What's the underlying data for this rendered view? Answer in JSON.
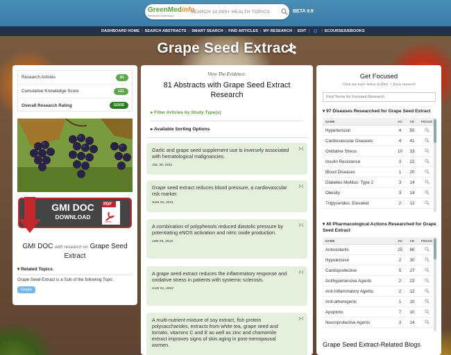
{
  "header": {
    "logo_main": "GreenMed",
    "logo_accent": "info",
    "logo_sub": "Research Dashboard",
    "search_placeholder": "SEARCH 10,000+ HEALTH TOPICS",
    "beta": "BETA 9.8"
  },
  "nav": {
    "items": [
      "DASHBOARD HOME",
      "SEARCH ABSTRACTS",
      "SMART SEARCH",
      "FIND ARTICLES",
      "MY RESEARCH",
      "EDIT"
    ],
    "google_glyph": "G",
    "last": "ECOURSES/EBOOKS"
  },
  "page": {
    "title": "Grape Seed Extract"
  },
  "stats": [
    {
      "label": "Research Articles",
      "value": "81"
    },
    {
      "label": "Cumulative Knowledge Score",
      "value": "131"
    },
    {
      "label": "Overall Research Rating",
      "value": "GOOD"
    }
  ],
  "gmi": {
    "title": "GMI DOC",
    "sub": "DOWNLOAD",
    "pdf": "PDF",
    "adobe": "Adobe",
    "caption_a": "GMI DOC",
    "caption_small": "with research on",
    "caption_b": "Grape Seed Extract"
  },
  "related": {
    "heading": "Related Topics",
    "desc": "Grape Seed Extract is a Sub of the following Topic",
    "tag": "Grape"
  },
  "middle": {
    "view_evidence": "View The Evidence:",
    "abstracts_title": "81 Abstracts with Grape Seed Extract Research",
    "filter_link": "Filter Articles by Study Type(s)",
    "sort_link": "Available Sorting Options",
    "cards": [
      {
        "title": "Garlic and grape seed supplement use is inversely associated with hematological malignancies.",
        "date": "JUL 29, 2011",
        "plus": "[+]"
      },
      {
        "title": "Grape seed extract reduces blood pressure, a cardiovascular risk marker.",
        "date": "AUG 01, 2011",
        "plus": "[+]"
      },
      {
        "title": "A combination of polyphenols reduced diastolic pressure by potentiating eNOS activation and nitric oxide production.",
        "date": "JUN 09, 2015",
        "plus": "[+]"
      },
      {
        "title": "A grape seed extract reduces the inflammatory response and oxidative stress in patients with systemic sclerosis.",
        "date": "AUG 01, 2002",
        "plus": "[+]"
      },
      {
        "title": "A multi-nutrient mixture of soy extract, fish protein polysaccharides, extracts from white tea, grape seed and tomato, vitamins C and E as well as zinc and chamomile extract improves signs of skin aging in post-menopausal women.",
        "date": "",
        "plus": "[+]"
      }
    ]
  },
  "right": {
    "title": "Get Focused",
    "subtitle": "Click any topic below to filter + focus research",
    "find_placeholder": "Find Terms for Focused Research",
    "diseases_heading": "97 Diseases Researched for Grape Seed Extract",
    "pharma_heading": "40 Pharmacological Actions Researched for Grape Seed Extract",
    "col_name": "NAME",
    "col_ac": "AC",
    "col_ck": "CK",
    "col_focus": "FOCUS",
    "diseases": [
      {
        "name": "Hypertension",
        "ac": "4",
        "ck": "50"
      },
      {
        "name": "Cardiovascular Diseases",
        "ac": "4",
        "ck": "41"
      },
      {
        "name": "Oxidative Stress",
        "ac": "10",
        "ck": "33"
      },
      {
        "name": "Insulin Resistance",
        "ac": "3",
        "ck": "22"
      },
      {
        "name": "Blood Diseases",
        "ac": "1",
        "ck": "20"
      },
      {
        "name": "Diabetes Mellitus: Type 2",
        "ac": "3",
        "ck": "14"
      },
      {
        "name": "Obesity",
        "ac": "3",
        "ck": "14"
      },
      {
        "name": "Triglycerides: Elevated",
        "ac": "2",
        "ck": "12"
      }
    ],
    "pharma": [
      {
        "name": "Antioxidants",
        "ac": "25",
        "ck": "86"
      },
      {
        "name": "Hypotensive",
        "ac": "2",
        "ck": "30"
      },
      {
        "name": "Cardioprotective",
        "ac": "5",
        "ck": "27"
      },
      {
        "name": "Antihypertensive Agents",
        "ac": "2",
        "ck": "22"
      },
      {
        "name": "Anti-Inflammatory Agents",
        "ac": "2",
        "ck": "12"
      },
      {
        "name": "Anti-atherogenic",
        "ac": "1",
        "ck": "10"
      },
      {
        "name": "Apoptotic",
        "ac": "7",
        "ck": "10"
      },
      {
        "name": "Neuroprotective Agents",
        "ac": "3",
        "ck": "14"
      }
    ],
    "blogs_title": "Grape Seed Extract-Related Blogs"
  }
}
